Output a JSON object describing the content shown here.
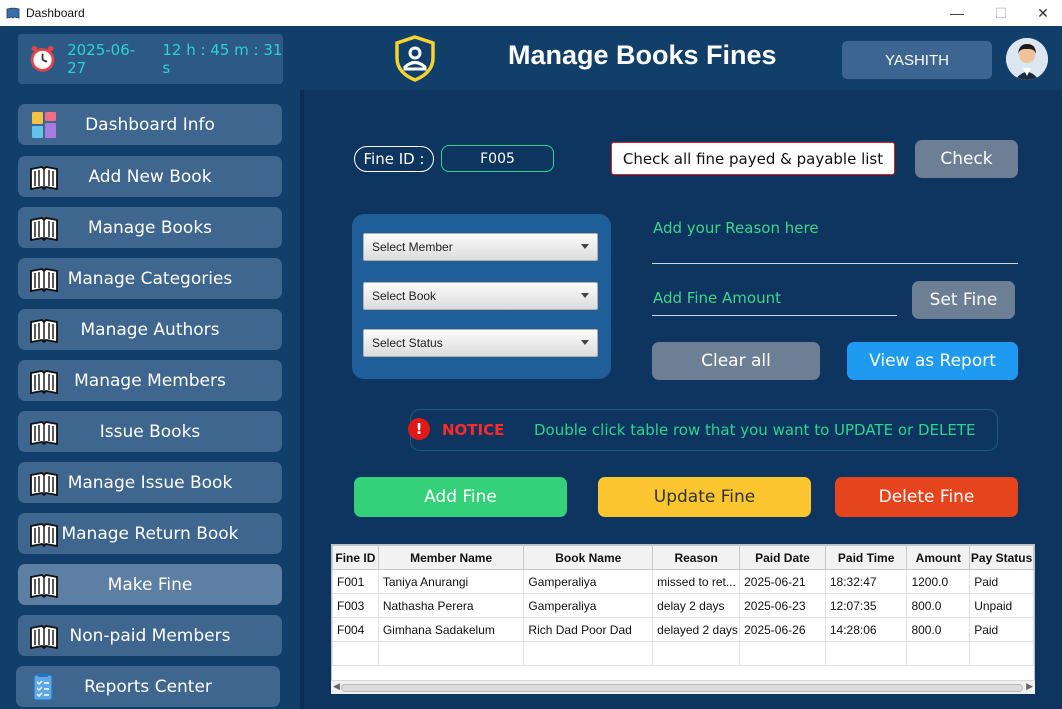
{
  "window": {
    "title": "Dashboard",
    "minimize": "—",
    "maximize": "☐",
    "close": "✕"
  },
  "header": {
    "date": "2025-06-27",
    "time": "12 h : 45 m : 31 s",
    "page_title": "Manage Books Fines",
    "username": "YASHITH"
  },
  "sidebar": {
    "items": [
      {
        "label": "Dashboard Info",
        "icon": "dashboard-icon"
      },
      {
        "label": "Add New Book",
        "icon": "book-icon"
      },
      {
        "label": "Manage Books",
        "icon": "book-icon"
      },
      {
        "label": "Manage Categories",
        "icon": "book-icon"
      },
      {
        "label": "Manage Authors",
        "icon": "book-icon"
      },
      {
        "label": "Manage Members",
        "icon": "book-icon"
      },
      {
        "label": "Issue Books",
        "icon": "book-icon"
      },
      {
        "label": "Manage Issue Book",
        "icon": "book-icon"
      },
      {
        "label": "Manage Return Book",
        "icon": "book-icon"
      },
      {
        "label": "Make Fine",
        "icon": "book-icon"
      },
      {
        "label": "Non-paid Members",
        "icon": "book-icon"
      },
      {
        "label": "Reports Center",
        "icon": "report-icon"
      }
    ]
  },
  "form": {
    "fine_id_label": "Fine ID :",
    "fine_id_value": "F005",
    "check_list_label": "Check all fine payed & payable list",
    "check_button": "Check",
    "select_member": "Select Member",
    "select_book": "Select Book",
    "select_status": "Select Status",
    "reason_placeholder": "Add your Reason here",
    "amount_placeholder": "Add Fine Amount",
    "set_fine_button": "Set Fine",
    "clear_button": "Clear all",
    "report_button": "View as Report"
  },
  "notice": {
    "title": "NOTICE",
    "text": "Double click table row that you want to  UPDATE  or DELETE"
  },
  "actions": {
    "add": "Add Fine",
    "update": "Update Fine",
    "delete": "Delete Fine"
  },
  "colors": {
    "add": "#35d07a",
    "update": "#fbc62f",
    "delete": "#e5441d",
    "report": "#1e9bf0",
    "clear": "#6c7f95",
    "check": "#6c7f95",
    "set_fine": "#6c7f95"
  },
  "table": {
    "columns": [
      "Fine ID",
      "Member Name",
      "Book Name",
      "Reason",
      "Paid Date",
      "Paid Time",
      "Amount",
      "Pay Status"
    ],
    "rows": [
      [
        "F001",
        "Taniya Anurangi",
        "Gamperaliya",
        "missed to ret...",
        "2025-06-21",
        "18:32:47",
        "1200.0",
        "Paid"
      ],
      [
        "F003",
        "Nathasha Perera",
        "Gamperaliya",
        "delay 2 days",
        "2025-06-23",
        "12:07:35",
        "800.0",
        "Unpaid"
      ],
      [
        "F004",
        "Gimhana Sadakelum",
        "Rich Dad Poor Dad",
        "delayed 2 days",
        "2025-06-26",
        "14:28:06",
        "800.0",
        "Paid"
      ]
    ]
  }
}
